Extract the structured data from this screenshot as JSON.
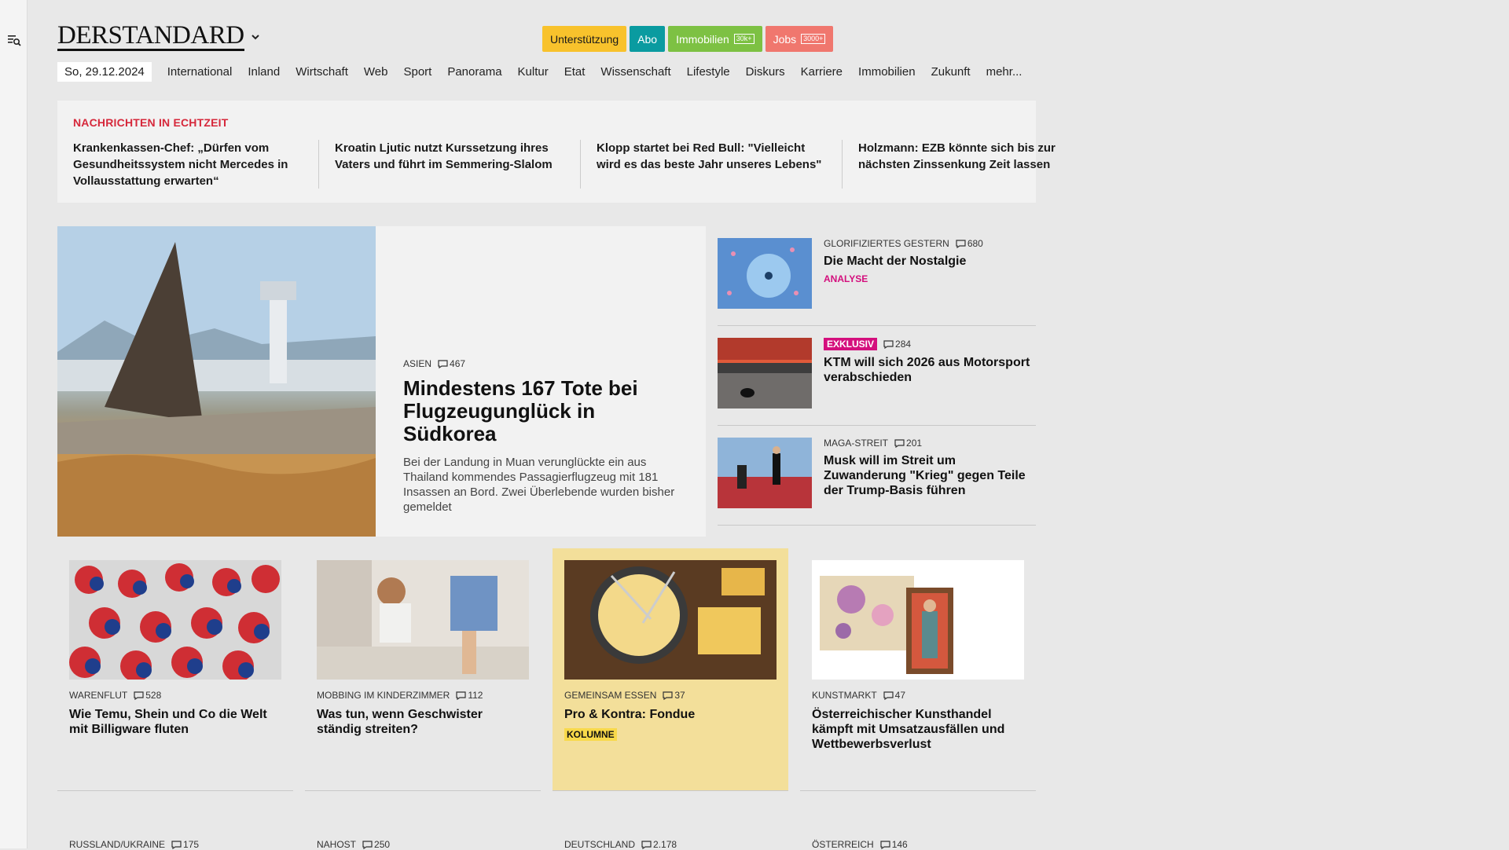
{
  "sidebar": {
    "search_menu_icon": "menu-search-icon"
  },
  "header": {
    "logo_text": "DERSTANDARD",
    "promo": [
      {
        "label": "Unterstützung",
        "bg": "#f8c22c",
        "color": "#1a1a1a",
        "badge": ""
      },
      {
        "label": "Abo",
        "bg": "#0a9ba0",
        "color": "#ffffff",
        "badge": ""
      },
      {
        "label": "Immobilien",
        "bg": "#7dc143",
        "color": "#ffffff",
        "badge": "30k+"
      },
      {
        "label": "Jobs",
        "bg": "#f0776e",
        "color": "#ffffff",
        "badge": "3000+"
      }
    ]
  },
  "nav": {
    "date": "So, 29.12.2024",
    "items": [
      "International",
      "Inland",
      "Wirtschaft",
      "Web",
      "Sport",
      "Panorama",
      "Kultur",
      "Etat",
      "Wissenschaft",
      "Lifestyle",
      "Diskurs",
      "Karriere",
      "Immobilien",
      "Zukunft",
      "mehr..."
    ]
  },
  "ticker": {
    "title": "NACHRICHTEN IN ECHTZEIT",
    "items": [
      "Krankenkassen-Chef: „Dürfen vom Gesundheitssystem nicht Mercedes in Vollausstattung erwarten“",
      "Kroatin Ljutic nutzt Kurssetzung ihres Vaters und führt im Semmering-Slalom",
      "Klopp startet bei Red Bull: \"Vielleicht wird es das beste Jahr unseres Lebens\"",
      "Holzmann: EZB könnte sich bis zur nächsten Zinssenkung Zeit lassen"
    ]
  },
  "lead": {
    "kicker": "ASIEN",
    "comments": "467",
    "title": "Mindestens 167 Tote bei Flug­zeugunglück in Südkorea",
    "teaser": "Bei der Landung in Muan verunglückte ein aus Thailand kommendes Passagierflugzeug mit 181 Insassen an Bord. Zwei Überlebende wurden bisher gemeldet"
  },
  "side": [
    {
      "kicker": "GLORIFIZIERTES GESTERN",
      "comments": "680",
      "title": "Die Macht der Nostalgie",
      "label": "ANALYSE",
      "tag": ""
    },
    {
      "kicker": "",
      "comments": "284",
      "title": "KTM will sich 2026 aus Motorsport verabschieden",
      "label": "",
      "tag": "EXKLUSIV"
    },
    {
      "kicker": "MAGA-STREIT",
      "comments": "201",
      "title": "Musk will im Streit um Zuwanderung \"Krieg\" gegen Teile der Trump-Basis führen",
      "label": "",
      "tag": ""
    }
  ],
  "cards": [
    {
      "kicker": "WARENFLUT",
      "comments": "528",
      "title": "Wie Temu, Shein und Co die Welt mit Billigware fluten",
      "label": ""
    },
    {
      "kicker": "MOBBING IM KINDERZIMMER",
      "comments": "112",
      "title": "Was tun, wenn Geschwister ständig streiten?",
      "label": ""
    },
    {
      "kicker": "GEMEINSAM ESSEN",
      "comments": "37",
      "title": "Pro & Kontra: Fondue",
      "label": "KOLUMNE"
    },
    {
      "kicker": "KUNSTMARKT",
      "comments": "47",
      "title": "Österreichischer Kunsthandel kämpft mit Umsatzausfällen und Wettbewerbsverlust",
      "label": ""
    }
  ],
  "bottom": [
    {
      "kicker": "RUSSLAND/UKRAINE",
      "comments": "175"
    },
    {
      "kicker": "NAHOST",
      "comments": "250"
    },
    {
      "kicker": "DEUTSCHLAND",
      "comments": "2.178"
    },
    {
      "kicker": "ÖSTERREICH",
      "comments": "146"
    }
  ]
}
